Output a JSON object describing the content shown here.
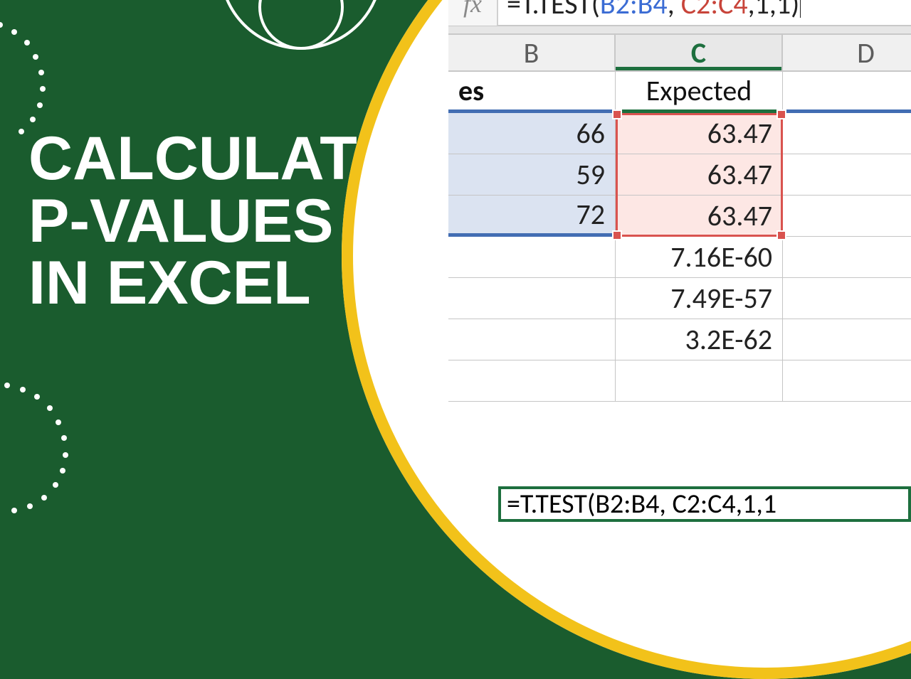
{
  "headline": {
    "line1": "CALCULATE",
    "line2": "P-VALUES",
    "line3": "IN EXCEL"
  },
  "formula_bar": {
    "fx_label": "fx",
    "eq": "=",
    "fn_open": "T.TEST(",
    "range1": "B2:B4",
    "sep1": ", ",
    "range2": "C2:C4",
    "tail": ",1,1)"
  },
  "columns": {
    "B": "B",
    "C": "C",
    "D": "D"
  },
  "sheet": {
    "header_B_fragment": "es",
    "header_C": "Expected",
    "rows_B": [
      "66",
      "59",
      "72"
    ],
    "rows_C": [
      "63.47",
      "63.47",
      "63.47"
    ],
    "below_C": [
      "7.16E-60",
      "7.49E-57",
      "3.2E-62"
    ]
  },
  "formula_echo": "=T.TEST(B2:B4, C2:C4,1,1"
}
